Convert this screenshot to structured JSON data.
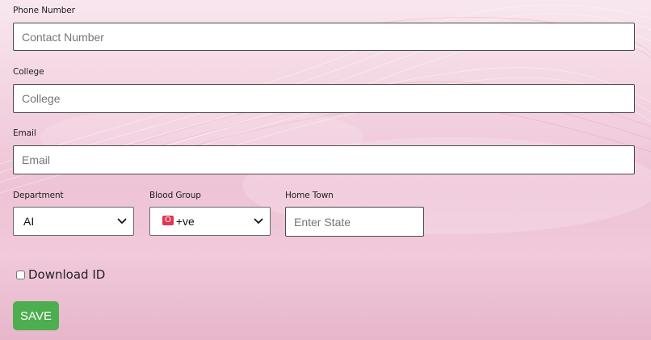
{
  "form": {
    "phone": {
      "label": "Phone Number",
      "placeholder": "Contact Number"
    },
    "college": {
      "label": "College",
      "placeholder": "College"
    },
    "email": {
      "label": "Email",
      "placeholder": "Email"
    },
    "department": {
      "label": "Department",
      "selected": "AI"
    },
    "blood_group": {
      "label": "Blood Group",
      "badge": "O",
      "suffix": "+ve"
    },
    "home_town": {
      "label": "Home Town",
      "placeholder": "Enter State"
    },
    "download_id": {
      "label": "Download ID",
      "checked": false
    },
    "save_label": "SAVE"
  },
  "colors": {
    "save_button": "#4cae4f",
    "badge": "#e0364f",
    "background": "#f0c9da"
  }
}
